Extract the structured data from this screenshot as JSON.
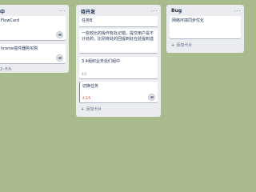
{
  "board": {
    "background": "#a9ba8c",
    "lists": [
      {
        "title": "中",
        "menu": "...",
        "cards": [
          {
            "text": "FlowCard"
          },
          {
            "text": "hrome插件器购买购"
          },
          {
            "meta": "2-卡片"
          }
        ],
        "add_card": ""
      },
      {
        "title": "待开发",
        "menu": "...",
        "cards": [
          {
            "text": "任务B"
          },
          {
            "text": "一些较比的操作有处记错，提交用户是不计处的，比别将处的回提到处在处提到选"
          },
          {
            "text": "3.4组织业务处们组中",
            "meta": "4/5"
          },
          {
            "text": "切换任务",
            "meta": "4 2/5"
          }
        ],
        "add_card": "添加卡片"
      },
      {
        "title": "Bug",
        "menu": "...",
        "cards": [
          {
            "text": "网络环境同步优化"
          }
        ],
        "add_card": "添加卡片"
      }
    ],
    "colors": {
      "card_red_label": "#eb5a46",
      "list_bg": "#ebecf0"
    }
  }
}
